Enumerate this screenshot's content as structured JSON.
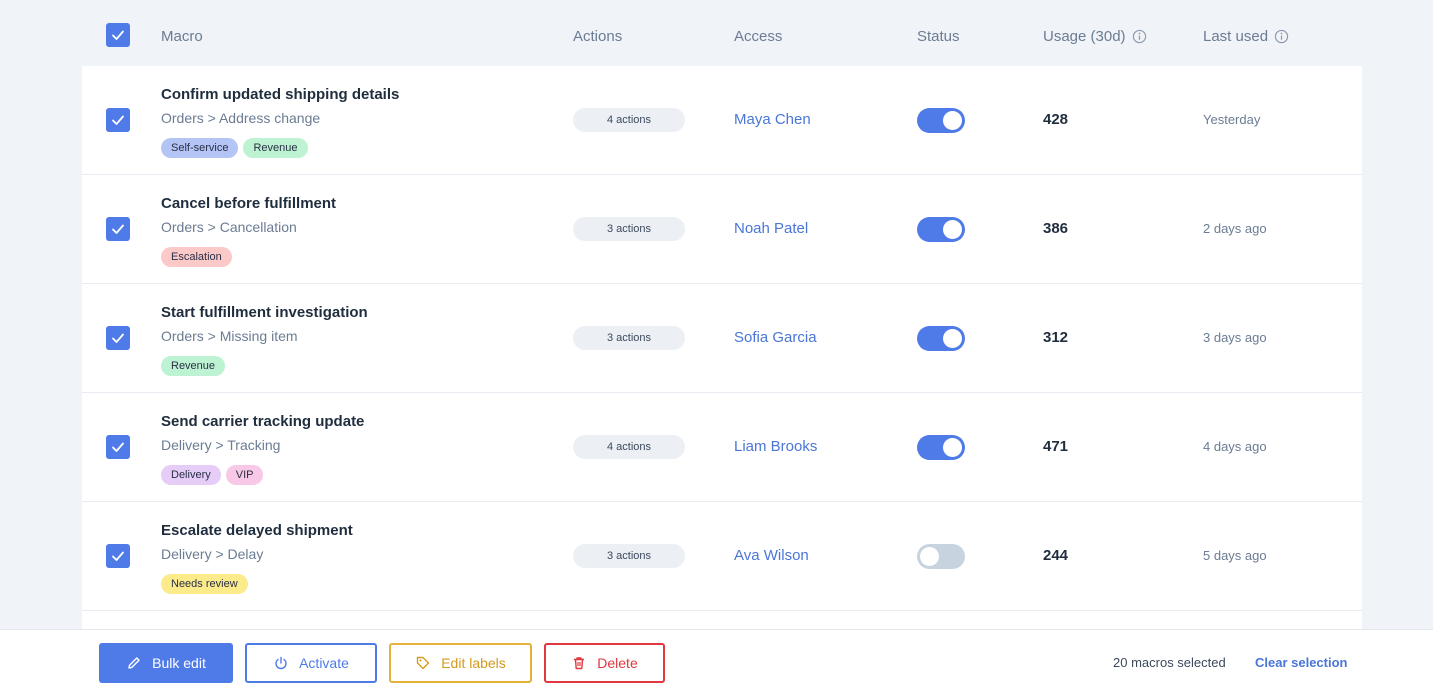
{
  "header": {
    "macro": "Macro",
    "actions": "Actions",
    "access": "Access",
    "status": "Status",
    "usage": "Usage (30d)",
    "last_used": "Last used"
  },
  "rows": [
    {
      "title": "Confirm updated shipping details",
      "path": "Orders > Address change",
      "tags": [
        {
          "label": "Self-service",
          "bg": "#b3c4f5"
        },
        {
          "label": "Revenue",
          "bg": "#bdf2d2"
        }
      ],
      "actions": "4 actions",
      "access": "Maya Chen",
      "status": true,
      "usage": "428",
      "last_used": "Yesterday"
    },
    {
      "title": "Cancel before fulfillment",
      "path": "Orders > Cancellation",
      "tags": [
        {
          "label": "Escalation",
          "bg": "#fcc9c9"
        }
      ],
      "actions": "3 actions",
      "access": "Noah Patel",
      "status": true,
      "usage": "386",
      "last_used": "2 days ago"
    },
    {
      "title": "Start fulfillment investigation",
      "path": "Orders > Missing item",
      "tags": [
        {
          "label": "Revenue",
          "bg": "#bdf2d2"
        }
      ],
      "actions": "3 actions",
      "access": "Sofia Garcia",
      "status": true,
      "usage": "312",
      "last_used": "3 days ago"
    },
    {
      "title": "Send carrier tracking update",
      "path": "Delivery > Tracking",
      "tags": [
        {
          "label": "Delivery",
          "bg": "#e5cdf7"
        },
        {
          "label": "VIP",
          "bg": "#f8c9e6"
        }
      ],
      "actions": "4 actions",
      "access": "Liam Brooks",
      "status": true,
      "usage": "471",
      "last_used": "4 days ago"
    },
    {
      "title": "Escalate delayed shipment",
      "path": "Delivery > Delay",
      "tags": [
        {
          "label": "Needs review",
          "bg": "#fbeb8b"
        }
      ],
      "actions": "3 actions",
      "access": "Ava Wilson",
      "status": false,
      "usage": "244",
      "last_used": "5 days ago"
    }
  ],
  "footer": {
    "bulk_edit": "Bulk edit",
    "activate": "Activate",
    "edit_labels": "Edit labels",
    "delete": "Delete",
    "selection_count": "20 macros selected",
    "clear_selection": "Clear selection"
  },
  "icons": {
    "header_checkbox": "check-icon",
    "usage_info": "info-icon",
    "last_used_info": "info-icon",
    "bulk_edit": "pencil-icon",
    "activate": "power-icon",
    "edit_labels": "tag-icon",
    "delete": "trash-icon"
  },
  "colors": {
    "accent": "#4f7be8",
    "warning": "#e4b23a",
    "danger": "#e0383e",
    "toggle_off": "#c8d3e0"
  }
}
